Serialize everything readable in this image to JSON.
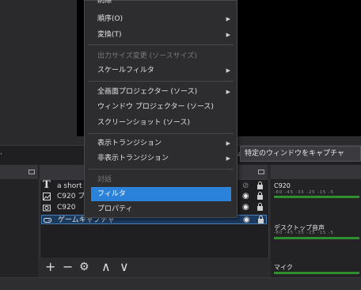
{
  "menu": {
    "top_partial": "削除",
    "order": "順序(O)",
    "transform": "変換(T)",
    "output_resize": "出力サイズ変更 (ソースサイズ)",
    "scale_filter": "スケールフィルタ",
    "fullscreen_projector": "全画面プロジェクター (ソース)",
    "windowed_projector": "ウィンドウ プロジェクター (ソース)",
    "screenshot": "スクリーンショット (ソース)",
    "show_transition": "表示トランジション",
    "hide_transition": "非表示トランジション",
    "interact": "対話",
    "filters": "フィルタ",
    "properties": "プロパティ"
  },
  "toolbar": {
    "mode_partial": "ード",
    "window_capture": "特定のウィンドウをキャプチャ"
  },
  "sources": [
    {
      "label": "a short",
      "icon": "text-icon"
    },
    {
      "label": "C920 ブ",
      "icon": "image-icon"
    },
    {
      "label": "C920",
      "icon": "camera-icon"
    },
    {
      "label": "ゲームキャプチャ",
      "icon": "gamepad-icon"
    }
  ],
  "mixer": {
    "channels": [
      "C920",
      "デスクトップ音声",
      "マイク"
    ],
    "ticks": "-60  -45  -35  -25  -15  -5"
  },
  "source_controls": {
    "add": "+",
    "remove": "−",
    "settings": "⚙",
    "up": "∧",
    "down": "∨"
  }
}
